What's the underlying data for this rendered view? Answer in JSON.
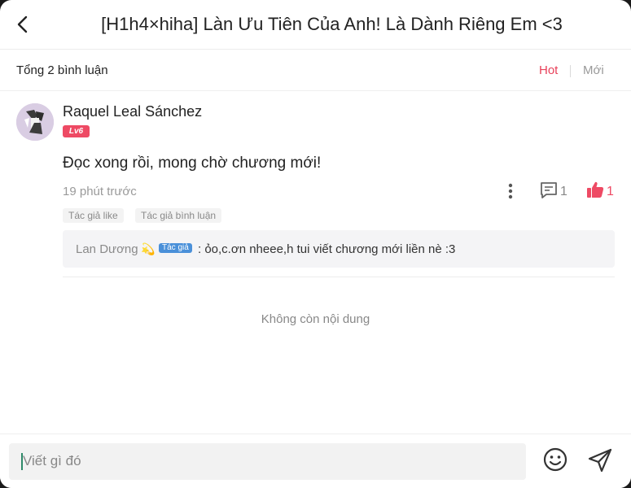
{
  "header": {
    "title": "[H1h4×hiha] Làn Ưu Tiên Của Anh! Là Dành Riêng Em <3",
    "back_icon": "chevron-left-icon"
  },
  "summary": {
    "total_label": "Tổng 2 bình luận",
    "sort_hot": "Hot",
    "sort_new": "Mới",
    "active_color": "#e8415a"
  },
  "comment": {
    "username": "Raquel Leal Sánchez",
    "level": "Lv6",
    "text": "Đọc xong rồi, mong chờ chương mới!",
    "time": "19 phút trước",
    "reply_count": "1",
    "like_count": "1",
    "tags": [
      "Tác giả like",
      "Tác giả bình luận"
    ],
    "reply": {
      "author": "Lan Dương",
      "emoji": "💫",
      "badge": "Tác giả",
      "text": ": ỏo,c.ơn nheee,h tui viết chương mới liền nè :3"
    }
  },
  "footer_note": "Không còn nội dung",
  "input": {
    "placeholder": "Viết gì đó",
    "emoji_icon": "smiley-icon",
    "send_icon": "send-icon"
  },
  "colors": {
    "accent": "#ee4a64",
    "author_badge": "#4a90d9"
  }
}
